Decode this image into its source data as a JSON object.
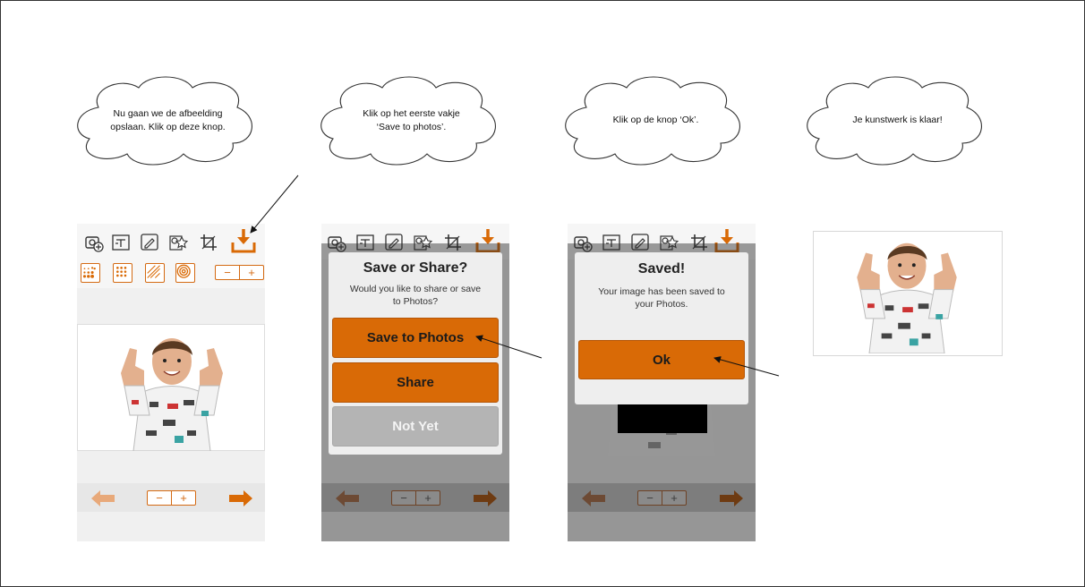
{
  "colors": {
    "accent": "#d96a06",
    "disabled": "#b4b4b4"
  },
  "clouds": [
    {
      "text": "Nu gaan we de afbeelding\nopslaan. Klik op deze knop."
    },
    {
      "text": "Klik op het eerste vakje\n‘Save to photos’."
    },
    {
      "text": "Klik op de knop ‘Ok’."
    },
    {
      "text": "Je kunstwerk is klaar!"
    }
  ],
  "toolbar_icons": [
    "add-photo-icon",
    "text-icon",
    "sticker-icon",
    "shapes-icon",
    "crop-icon",
    "download-icon"
  ],
  "effect_icons": [
    "halftone-icon",
    "dots-icon",
    "lines-icon",
    "circles-icon"
  ],
  "stepper": {
    "minus": "−",
    "plus": "+"
  },
  "nav": {
    "back": "back-arrow-icon",
    "next": "next-arrow-icon"
  },
  "dialog_share": {
    "title": "Save or Share?",
    "message": "Would you like to share or save to Photos?",
    "buttons": {
      "save": "Save to Photos",
      "share": "Share",
      "not_yet": "Not Yet"
    }
  },
  "dialog_saved": {
    "title": "Saved!",
    "message": "Your image has been saved to your Photos.",
    "ok": "Ok"
  }
}
